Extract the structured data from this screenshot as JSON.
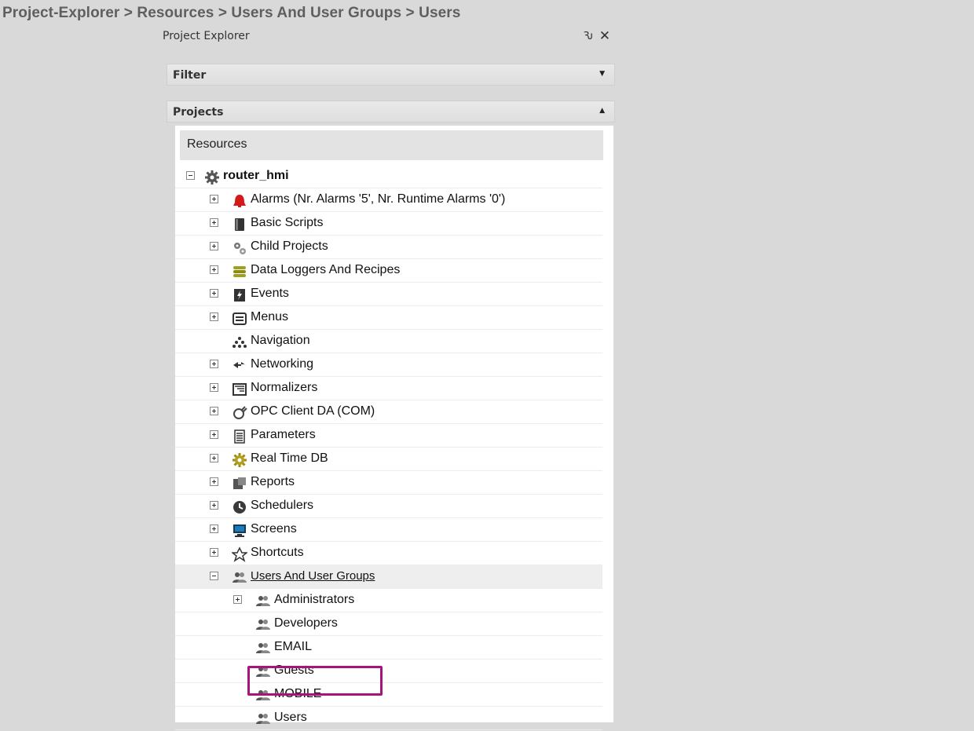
{
  "breadcrumb": "Project-Explorer > Resources > Users And User Groups > Users",
  "panel": {
    "title": "Project Explorer",
    "pin_glyph": "Ԅ",
    "close_glyph": "✕",
    "filter_label": "Filter",
    "projects_label": "Projects",
    "resources_label": "Resources"
  },
  "tree": {
    "root": "router_hmi",
    "items": [
      {
        "label": "Alarms (Nr. Alarms '5', Nr. Runtime Alarms '0')",
        "icon": "alarm-bell-icon"
      },
      {
        "label": "Basic Scripts",
        "icon": "script-icon"
      },
      {
        "label": "Child Projects",
        "icon": "child-projects-icon"
      },
      {
        "label": "Data Loggers And Recipes",
        "icon": "database-icon"
      },
      {
        "label": "Events",
        "icon": "event-icon"
      },
      {
        "label": "Menus",
        "icon": "menu-icon"
      },
      {
        "label": "Navigation",
        "icon": "navigation-icon"
      },
      {
        "label": "Networking",
        "icon": "networking-arrows-icon"
      },
      {
        "label": "Normalizers",
        "icon": "normalizer-icon"
      },
      {
        "label": "OPC Client DA (COM)",
        "icon": "opc-plug-icon"
      },
      {
        "label": "Parameters",
        "icon": "parameters-icon"
      },
      {
        "label": "Real Time DB",
        "icon": "realtime-db-gear-icon"
      },
      {
        "label": "Reports",
        "icon": "reports-icon"
      },
      {
        "label": "Schedulers",
        "icon": "clock-icon"
      },
      {
        "label": "Screens",
        "icon": "monitor-icon"
      },
      {
        "label": "Shortcuts",
        "icon": "shortcut-icon"
      },
      {
        "label": "Users And User Groups",
        "icon": "user-group-icon"
      }
    ],
    "groups": [
      {
        "label": "Administrators"
      },
      {
        "label": "Developers"
      },
      {
        "label": "EMAIL"
      },
      {
        "label": "Guests"
      },
      {
        "label": "MOBILE"
      },
      {
        "label": "Users"
      }
    ]
  },
  "colors": {
    "highlight_box": "#a8157a",
    "breadcrumb_text": "#5f5f5f"
  }
}
